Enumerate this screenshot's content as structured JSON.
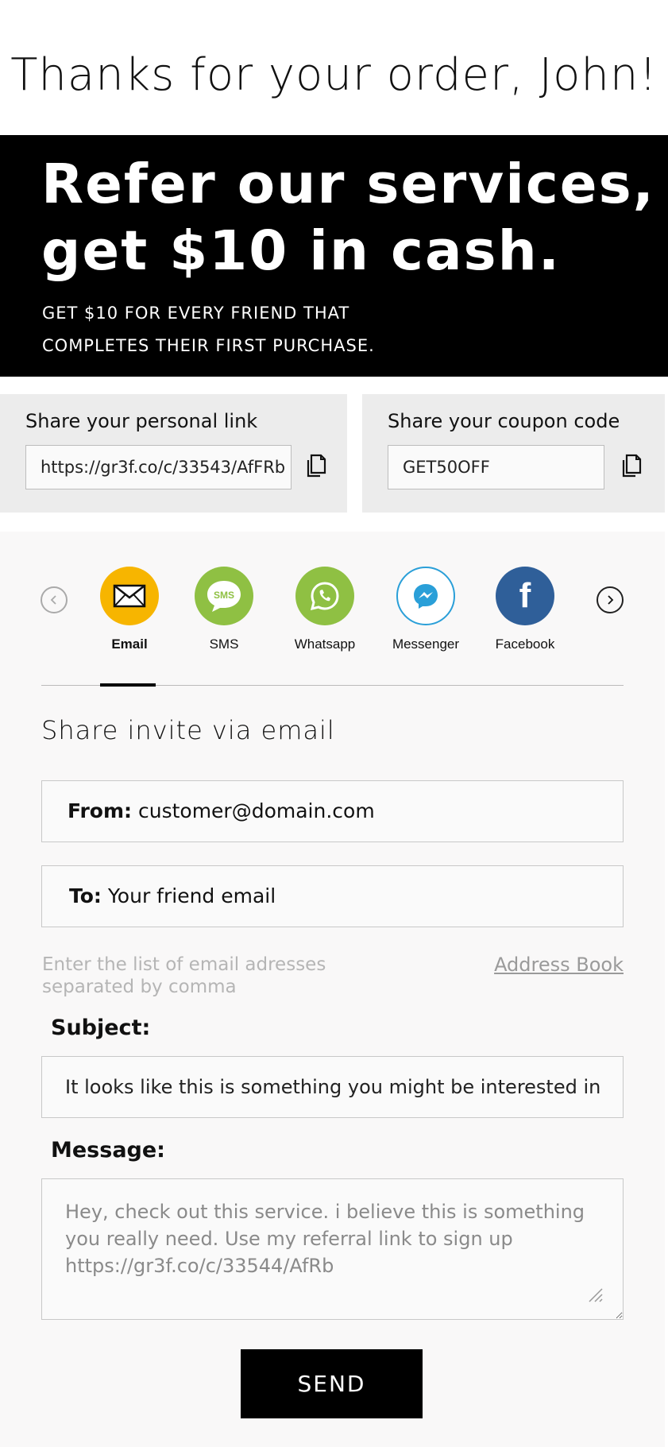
{
  "header": {
    "title": "Thanks for your order, John!"
  },
  "hero": {
    "headline": "Refer our services, get $10 in cash.",
    "subline_1": "GET $10 FOR EVERY FRIEND THAT",
    "subline_2": "COMPLETES THEIR FIRST PURCHASE."
  },
  "share_link": {
    "label": "Share your personal link",
    "value": "https://gr3f.co/c/33543/AfFRb"
  },
  "share_coupon": {
    "label": "Share your coupon code",
    "value": "GET50OFF"
  },
  "channels": [
    {
      "label": "Email",
      "icon": "envelope-icon",
      "color": "#f7b500",
      "active": true
    },
    {
      "label": "SMS",
      "icon": "sms-bubble-icon",
      "color": "#8fc043"
    },
    {
      "label": "Whatsapp",
      "icon": "whatsapp-icon",
      "color": "#8fc043"
    },
    {
      "label": "Messenger",
      "icon": "messenger-icon",
      "color": "#2a9fd8"
    },
    {
      "label": "Facebook",
      "icon": "facebook-icon",
      "color": "#2f5f99"
    }
  ],
  "sms_icon_text": "SMS",
  "facebook_icon_text": "f",
  "email_form": {
    "section_title": "Share invite via email",
    "from_label": "From:",
    "from_value": "customer@domain.com",
    "to_label": "To:",
    "to_placeholder": "Your friend email",
    "hint": "Enter the list of email adresses separated by comma",
    "address_book": "Address Book",
    "subject_label": "Subject:",
    "subject_value": "It looks like this is something you might be interested in",
    "message_label": "Message:",
    "message_value": "Hey, check out this service. i believe this is something you really need. Use my referral link to sign up https://gr3f.co/c/33544/AfRb",
    "send_label": "SEND"
  }
}
